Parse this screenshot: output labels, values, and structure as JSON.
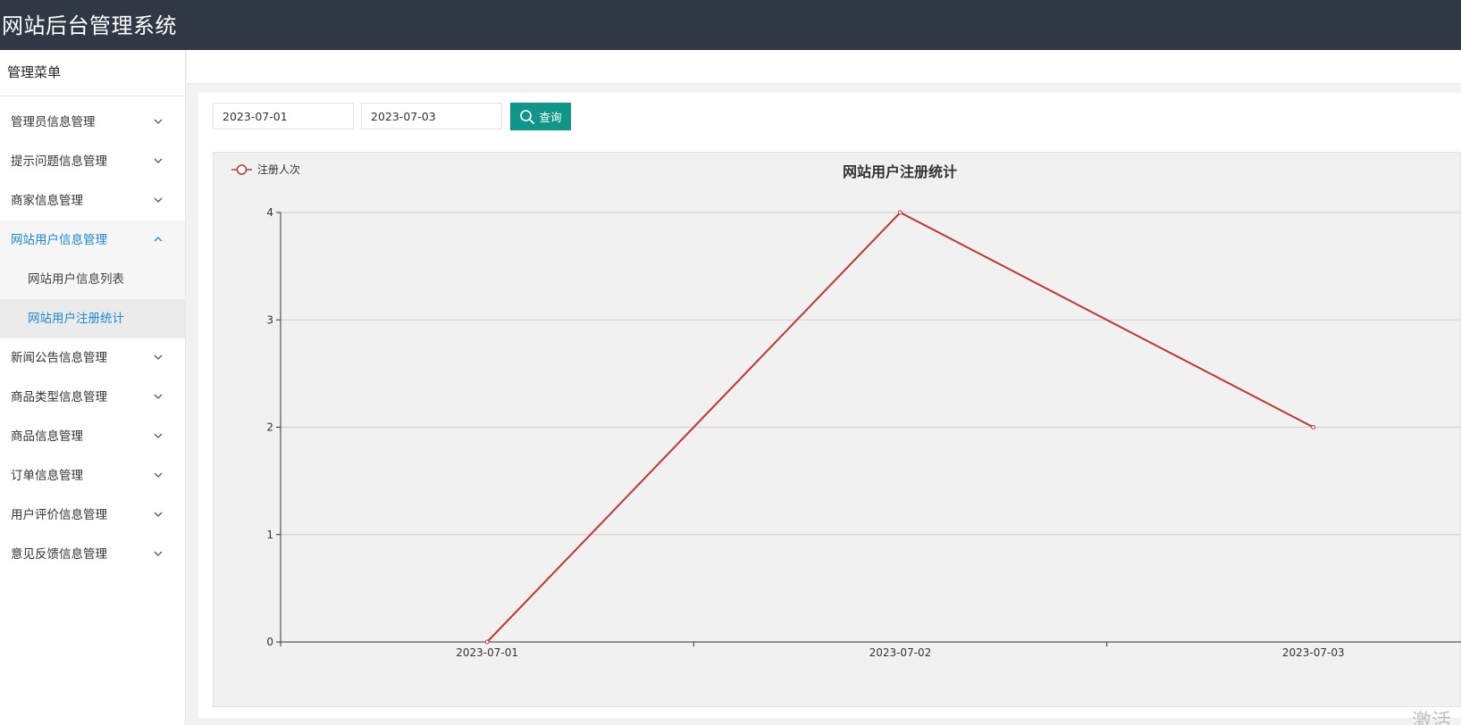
{
  "header": {
    "title": "网站后台管理系统"
  },
  "sidebar": {
    "title": "管理菜单",
    "items": [
      {
        "label": "管理员信息管理"
      },
      {
        "label": "提示问题信息管理"
      },
      {
        "label": "商家信息管理"
      },
      {
        "label": "网站用户信息管理",
        "expanded": true,
        "children": [
          {
            "label": "网站用户信息列表"
          },
          {
            "label": "网站用户注册统计"
          }
        ]
      },
      {
        "label": "新闻公告信息管理"
      },
      {
        "label": "商品类型信息管理"
      },
      {
        "label": "商品信息管理"
      },
      {
        "label": "订单信息管理"
      },
      {
        "label": "用户评价信息管理"
      },
      {
        "label": "意见反馈信息管理"
      }
    ]
  },
  "filter": {
    "start_date": "2023-07-01",
    "end_date": "2023-07-03",
    "query_label": "查询"
  },
  "icons": {
    "query": "search-icon",
    "menu_collapsed": "chevron-down-icon",
    "menu_expanded": "chevron-up-icon"
  },
  "colors": {
    "topbar": "#303846",
    "accent": "#1e88d8",
    "button": "#109688",
    "series": "#c23531"
  },
  "watermark": "激活",
  "chart_data": {
    "type": "line",
    "title": "网站用户注册统计",
    "categories": [
      "2023-07-01",
      "2023-07-02",
      "2023-07-03"
    ],
    "series": [
      {
        "name": "注册人次",
        "values": [
          0,
          4,
          2
        ]
      }
    ],
    "ylim": [
      0,
      4
    ],
    "yticks": [
      0,
      1,
      2,
      3,
      4
    ],
    "grid": true,
    "legend": "top-left"
  }
}
